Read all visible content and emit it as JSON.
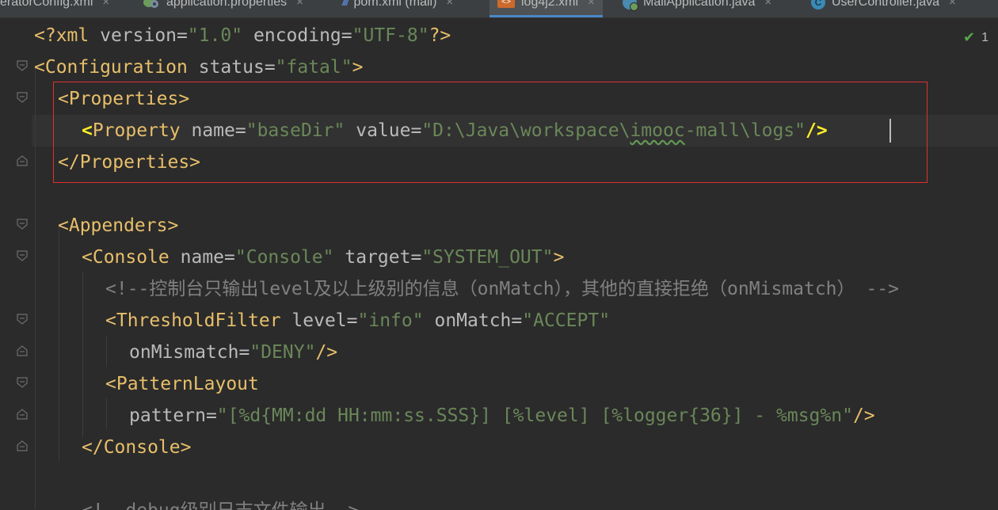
{
  "tabs": [
    {
      "label": "eratorConfig.xml",
      "icon": "xml-file-icon",
      "active": false
    },
    {
      "label": "application.properties",
      "icon": "properties-file-icon",
      "active": false
    },
    {
      "label": "pom.xml (mall)",
      "icon": "maven-icon",
      "active": false
    },
    {
      "label": "log4j2.xml",
      "icon": "xml-file-icon",
      "active": true
    },
    {
      "label": "MallApplication.java",
      "icon": "spring-boot-class-icon",
      "active": false
    },
    {
      "label": "UserController.java",
      "icon": "java-class-icon",
      "active": false
    }
  ],
  "tab_close_glyph": "×",
  "xml_icon_text": "<>",
  "class_icon_text": "C",
  "inspection": {
    "count": "1",
    "icon": "check-icon",
    "check_glyph": "✔"
  },
  "colors": {
    "background": "#2b2b2b",
    "tag": "#e8bf6a",
    "attribute": "#bababa",
    "value": "#6a8759",
    "comment": "#808080",
    "highlight_box": "#e03030"
  },
  "code": {
    "l1": {
      "a": "<?xml ",
      "b": "version",
      "c": "=",
      "d": "\"1.0\"",
      "e": " ",
      "f": "encoding",
      "g": "=",
      "h": "\"UTF-8\"",
      "i": "?>"
    },
    "l2": {
      "a": "<Configuration ",
      "b": "status",
      "c": "=",
      "d": "\"fatal\"",
      "e": ">"
    },
    "l3": {
      "a": "<Properties>"
    },
    "l4": {
      "a": "<",
      "b": "Property ",
      "c": "name",
      "d": "=",
      "e": "\"baseDir\"",
      "f": " ",
      "g": "value",
      "h": "=",
      "i": "\"D:\\Java\\workspace\\",
      "j": "imooc",
      "k": "-mall\\logs\"",
      "l": "/>"
    },
    "l5": {
      "a": "</Properties>"
    },
    "l6": {
      "a": "<Appenders>"
    },
    "l7": {
      "a": "<Console ",
      "b": "name",
      "c": "=",
      "d": "\"Console\"",
      "e": " ",
      "f": "target",
      "g": "=",
      "h": "\"SYSTEM_OUT\"",
      "i": ">"
    },
    "l8": {
      "a": "<!--控制台只输出level及以上级别的信息（onMatch），其他的直接拒绝（onMismatch） -->"
    },
    "l9": {
      "a": "<ThresholdFilter ",
      "b": "level",
      "c": "=",
      "d": "\"info\"",
      "e": " ",
      "f": "onMatch",
      "g": "=",
      "h": "\"ACCEPT\""
    },
    "l10": {
      "a": "onMismatch",
      "b": "=",
      "c": "\"DENY\"",
      "d": "/>"
    },
    "l11": {
      "a": "<PatternLayout"
    },
    "l12": {
      "a": "pattern",
      "b": "=",
      "c": "\"[%d{MM:dd HH:mm:ss.SSS}] [%level] [%logger{36}] - %msg%n\"",
      "d": "/>"
    },
    "l13": {
      "a": "</Console>"
    },
    "l14": {
      "a": "<!--debug级别日志文件输出-->"
    }
  }
}
